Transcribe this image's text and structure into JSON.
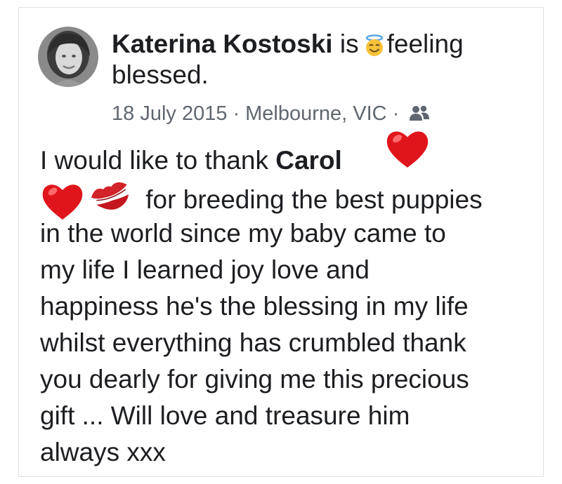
{
  "post": {
    "author_name": "Katerina Kostoski",
    "activity_prefix": "is",
    "activity_text": "feeling blessed.",
    "feeling_icon": "smiling-face-with-halo-icon",
    "date": "18 July 2015",
    "location": "Melbourne, VIC",
    "separator": "·",
    "privacy_icon": "friends-icon",
    "text": {
      "line1_before": "I would like to thank",
      "mention": "Carol",
      "line2_after": "for breeding the best puppies",
      "line3": "in the world since my baby came to",
      "line4": "my life I learned joy love and",
      "line5": "happiness he's the blessing in my life",
      "line6": "whilst everything has crumbled thank",
      "line7": "you dearly for giving me this precious",
      "line8": "gift ... Will love and treasure him",
      "line9": "always xxx"
    },
    "emojis": [
      "heart-icon",
      "heart-icon",
      "kiss-mark-icon"
    ]
  },
  "colors": {
    "text": "#1c1e21",
    "meta": "#606770",
    "border": "#dddfe2",
    "heart": "#e0151b"
  }
}
